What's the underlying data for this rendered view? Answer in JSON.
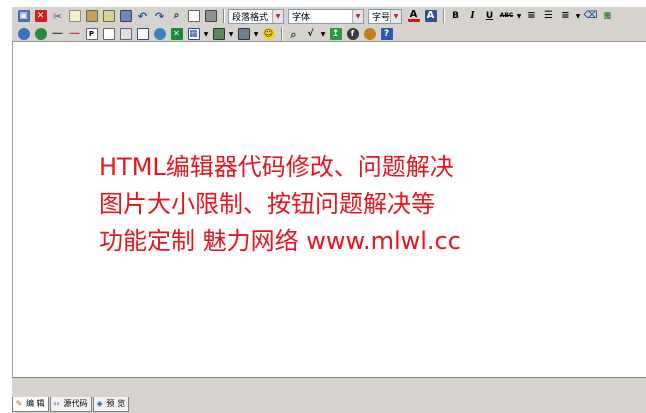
{
  "toolbar": {
    "row1": {
      "paragraph_select": "段落格式",
      "font_select": "字体",
      "size_select": "字号",
      "bold_label": "B",
      "italic_label": "I",
      "underline_label": "U",
      "strike_label": "ABC",
      "image_label": "图"
    }
  },
  "content": {
    "lines": [
      "HTML编辑器代码修改、问题解决",
      "图片大小限制、按钮问题解决等",
      "功能定制 魅力网络 www.mlwl.cc"
    ],
    "text_color": "#e8141e"
  },
  "modes": {
    "edit": "编  辑",
    "source": "源代码",
    "preview": "预  览"
  }
}
